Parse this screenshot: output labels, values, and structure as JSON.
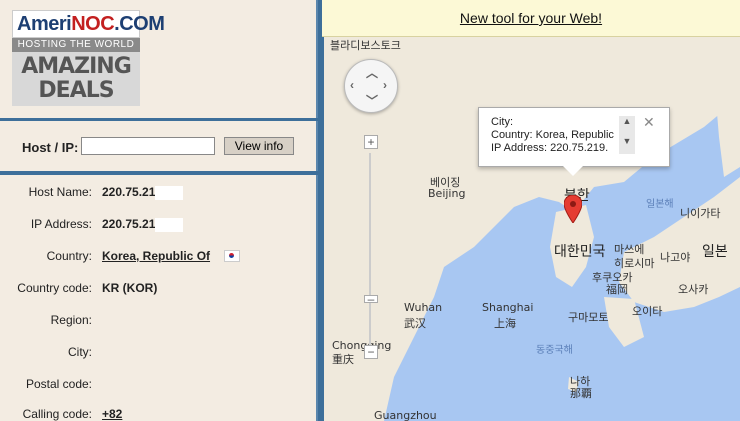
{
  "logo": {
    "brand_main": "Ameri",
    "brand_accent": "NOC",
    "brand_suffix": ".COM",
    "tagline": "HOSTING THE WORLD",
    "promo_line1": "AMAZING",
    "promo_line2": "DEALS"
  },
  "host_form": {
    "label": "Host / IP:",
    "input_value": "",
    "button_label": "View info"
  },
  "info": [
    {
      "key": "Host Name:",
      "value": "220.75.21",
      "redacted": true
    },
    {
      "key": "IP Address:",
      "value": "220.75.21",
      "redacted": true
    },
    {
      "key": "Country:",
      "value": "Korea, Republic Of",
      "link": true,
      "flag": true
    },
    {
      "key": "Country code:",
      "value": "KR (KOR)"
    },
    {
      "key": "Region:",
      "value": ""
    },
    {
      "key": "City:",
      "value": ""
    },
    {
      "key": "Postal code:",
      "value": ""
    },
    {
      "key": "Calling code:",
      "value": "+82",
      "link": true
    }
  ],
  "banner": {
    "text": "New tool for your Web!"
  },
  "map": {
    "labels": {
      "vladivostok": "블라디보스토크",
      "beijing_ko": "베이징",
      "beijing": "Beijing",
      "north": "북한",
      "japan_sea": "일본해",
      "niigata": "니이가타",
      "south_korea": "대한민국",
      "matsue": "마쓰에",
      "hiroshima": "히로시마",
      "nagoya": "나고야",
      "japan": "일본",
      "fukuoka_ko": "후쿠오카",
      "fukuoka": "福岡",
      "osaka": "오사카",
      "shanghai": "Shanghai",
      "shanghai_zh": "上海",
      "kumamoto": "구마모토",
      "oita": "오이타",
      "wuhan": "Wuhan",
      "wuhan_zh": "武汉",
      "chongqing": "Chongqing",
      "chongqing_zh": "重庆",
      "east_china_sea": "동중국해",
      "naha_ko": "나하",
      "naha": "那覇",
      "guangzhou": "Guangzhou"
    },
    "popup": {
      "city": "City:",
      "country": "Country: Korea, Republic",
      "ip": "IP Address: 220.75.219."
    }
  }
}
